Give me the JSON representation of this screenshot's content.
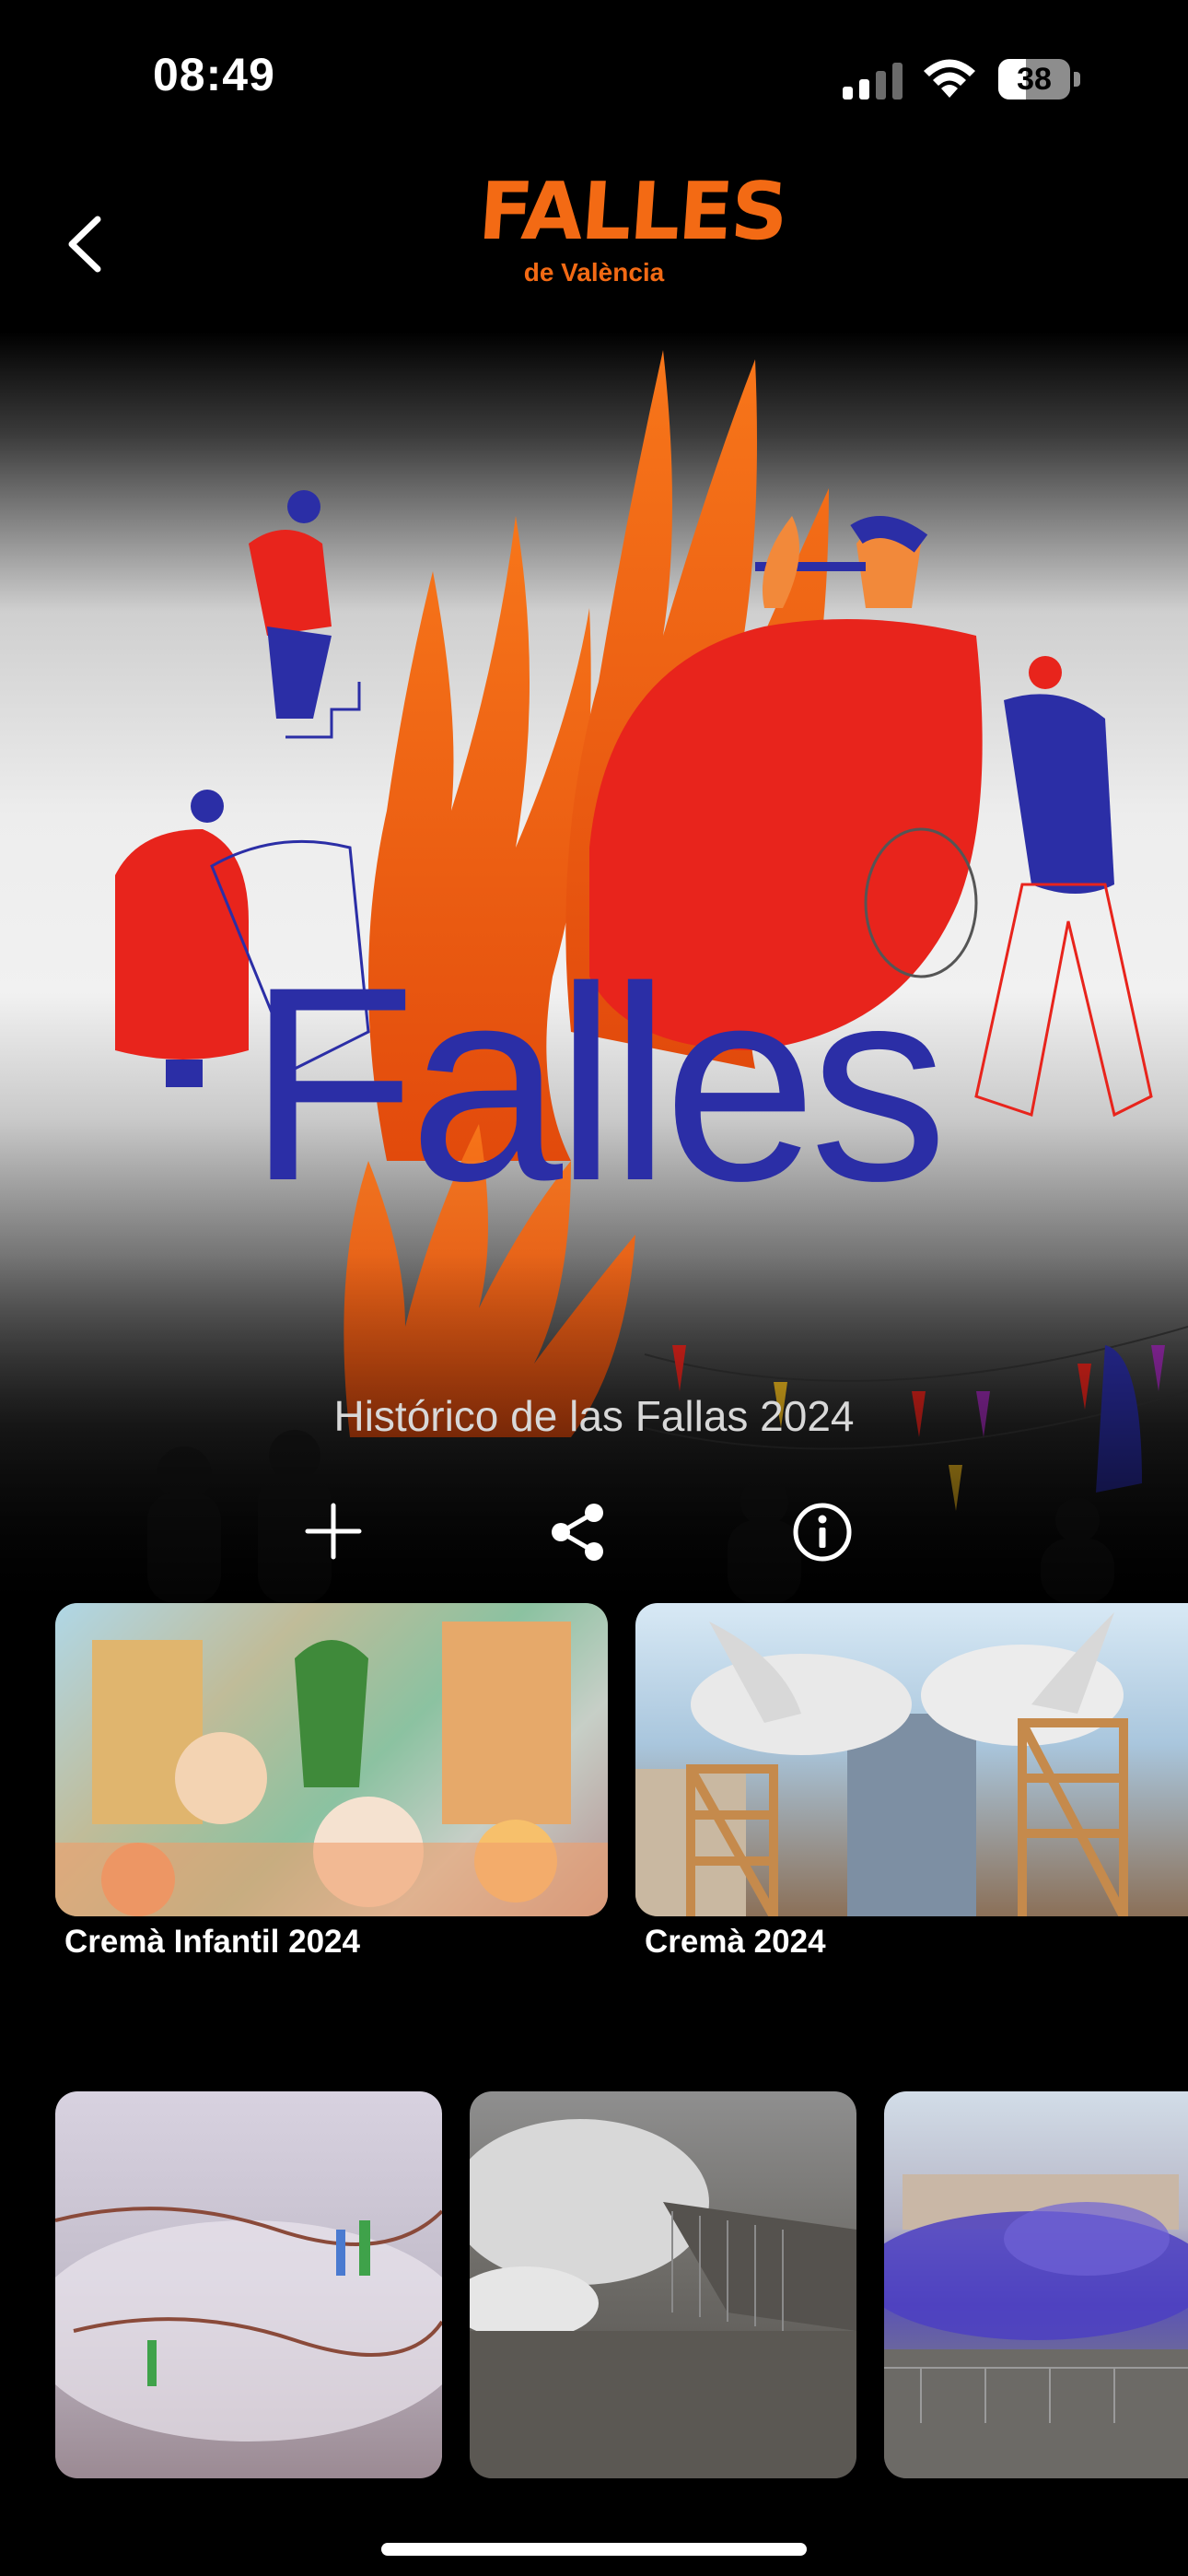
{
  "status_bar": {
    "time": "08:49",
    "battery_level": "38",
    "battery_fraction": 0.38
  },
  "header": {
    "logo_text": "FALLES",
    "logo_subtitle": "de València",
    "back_icon": "chevron-left-icon"
  },
  "hero": {
    "artwork_text": "Falles",
    "title": "Histórico de las Fallas 2024",
    "actions": [
      {
        "icon": "plus-icon",
        "name": "add"
      },
      {
        "icon": "share-icon",
        "name": "share"
      },
      {
        "icon": "info-icon",
        "name": "info"
      }
    ]
  },
  "featured": [
    {
      "label": "Cremà Infantil 2024"
    },
    {
      "label": "Cremà 2024"
    }
  ],
  "colors": {
    "brand_orange": "#f36a14",
    "artwork_blue": "#2b2ea6",
    "artwork_red": "#e8241c"
  }
}
